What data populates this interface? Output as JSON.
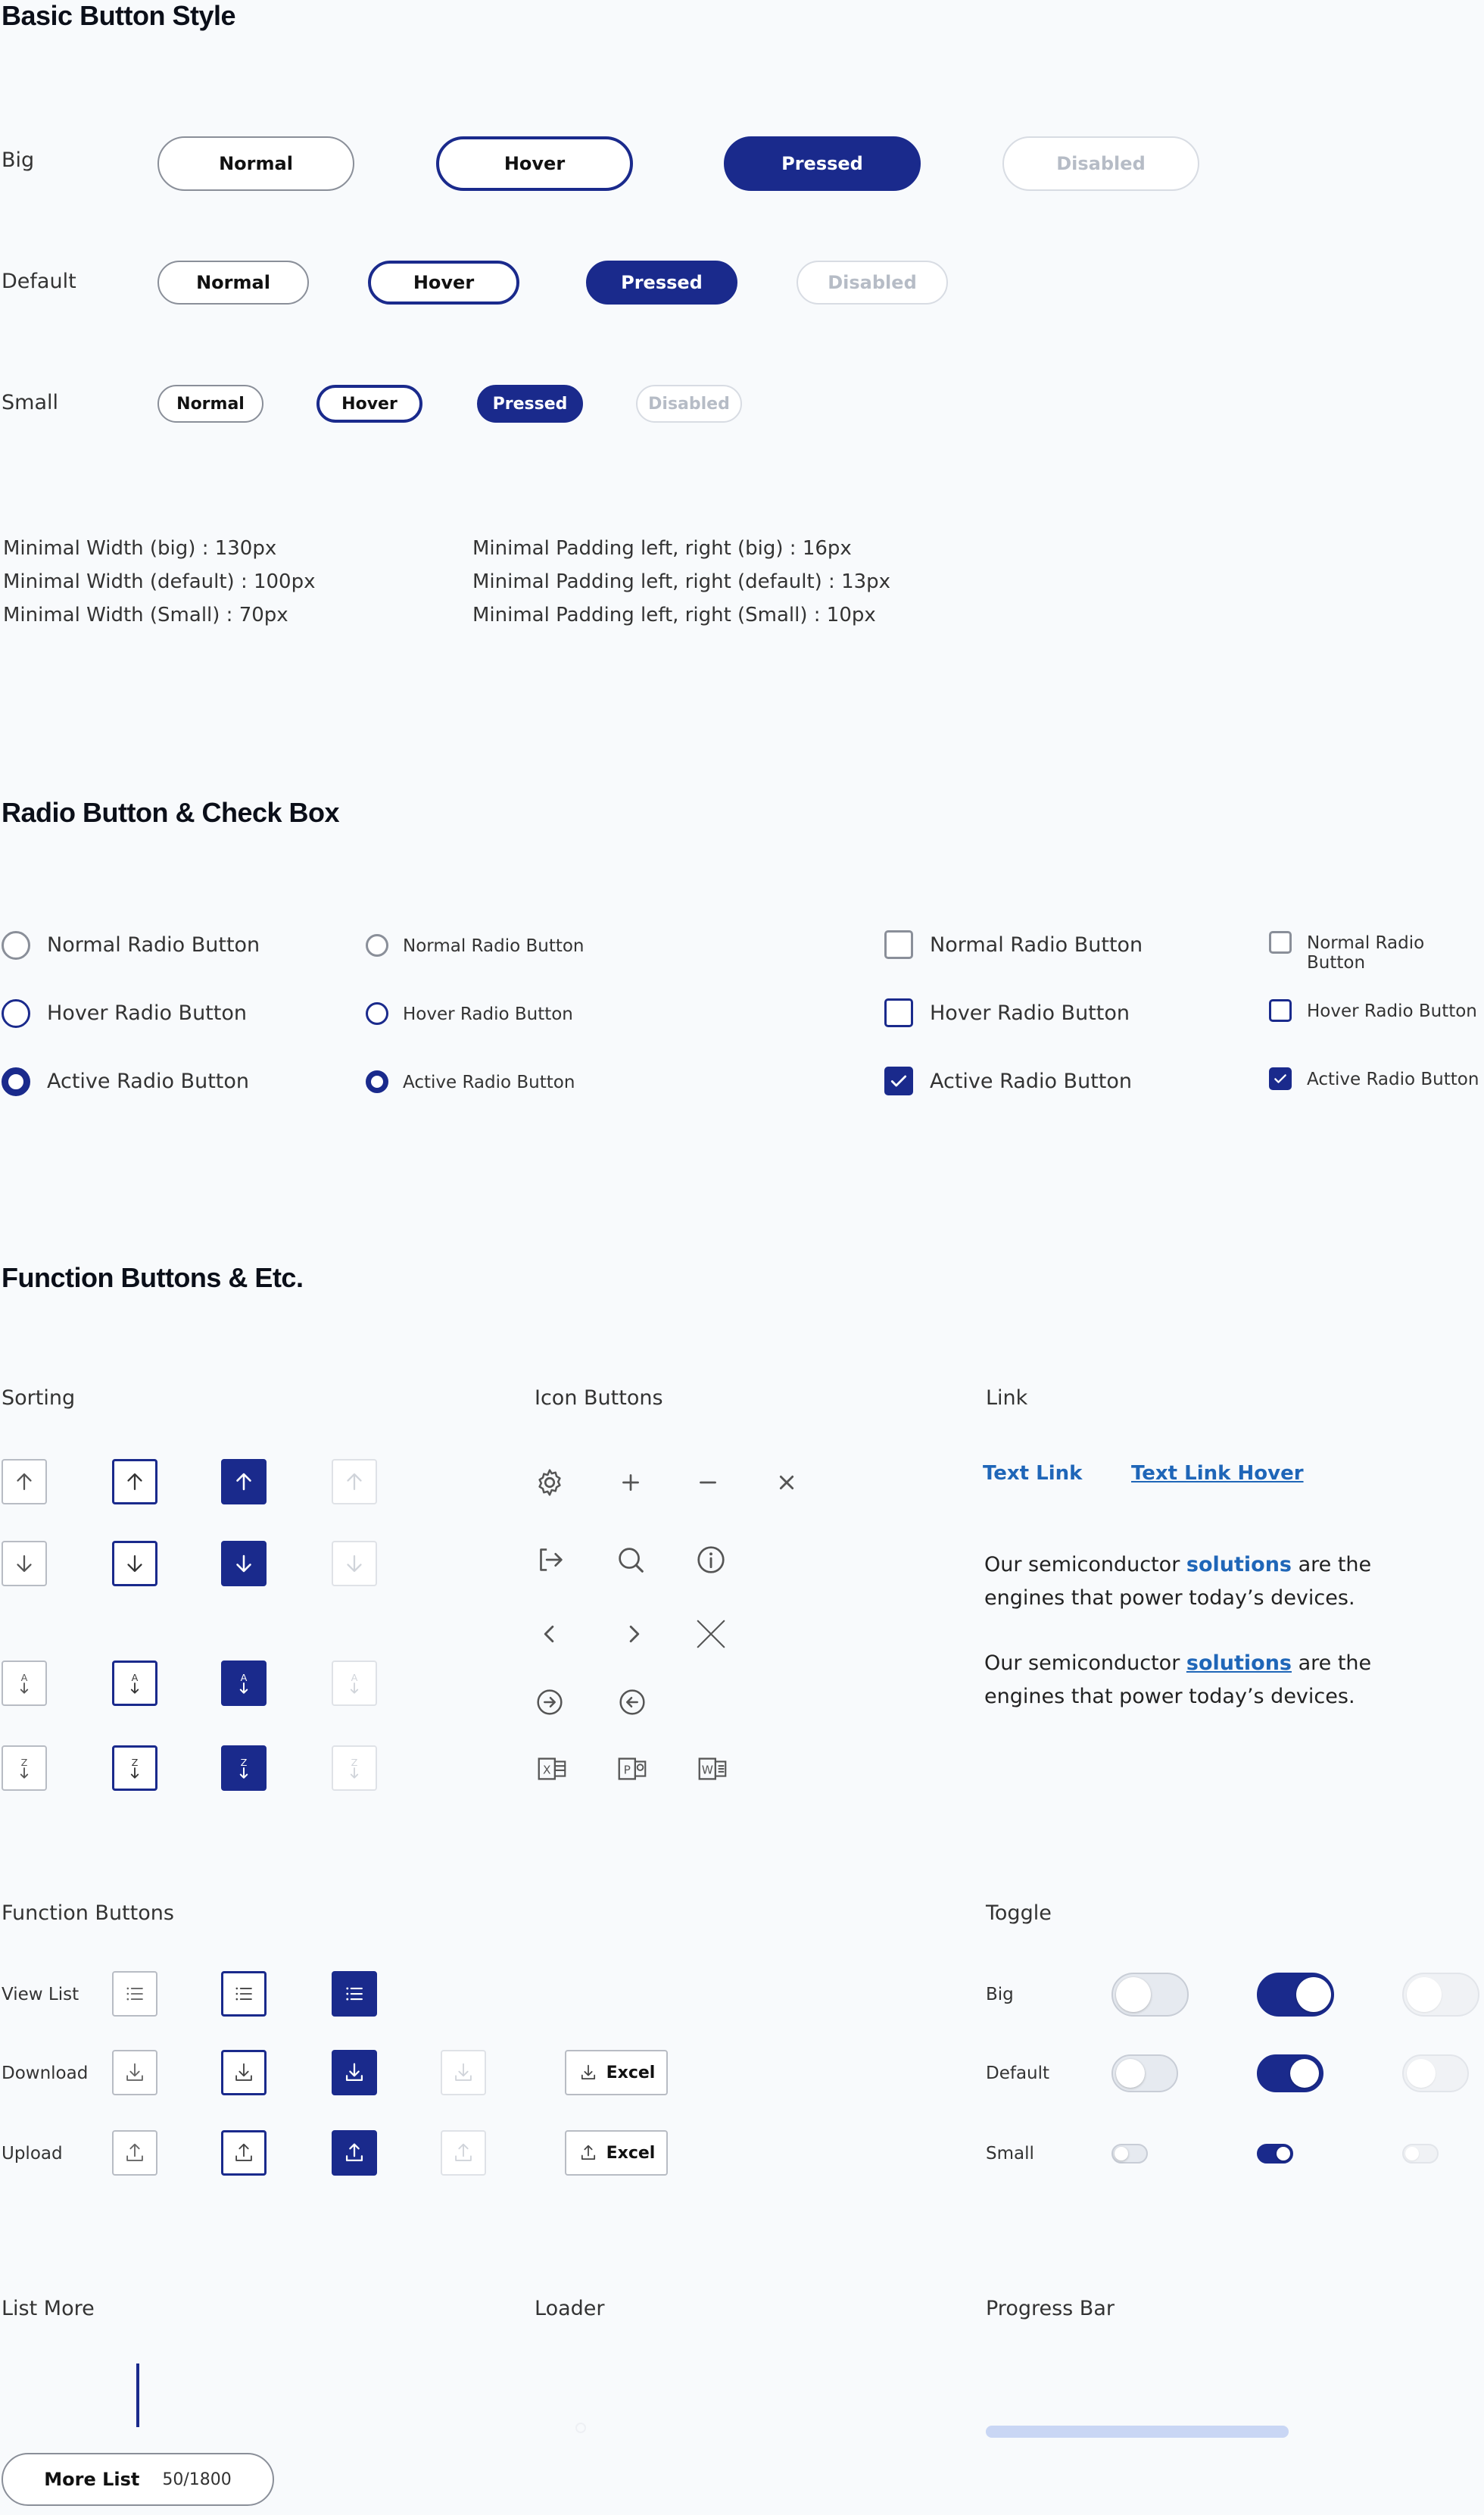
{
  "colors": {
    "primary": "#1a2a8c",
    "link": "#1f66b8",
    "border": "#8a8f99",
    "disabled": "#d8dce3"
  },
  "basic": {
    "title": "Basic Button Style",
    "rows": [
      {
        "label": "Big",
        "buttons": [
          "Normal",
          "Hover",
          "Pressed",
          "Disabled"
        ]
      },
      {
        "label": "Default",
        "buttons": [
          "Normal",
          "Hover",
          "Pressed",
          "Disabled"
        ]
      },
      {
        "label": "Small",
        "buttons": [
          "Normal",
          "Hover",
          "Pressed",
          "Disabled"
        ]
      }
    ],
    "notes_left": [
      "Minimal Width (big) : 130px",
      "Minimal Width (default) : 100px",
      "Minimal Width (Small) : 70px"
    ],
    "notes_right": [
      "Minimal Padding left, right (big) : 16px",
      "Minimal Padding left, right (default) : 13px",
      "Minimal Padding left, right (Small) : 10px"
    ]
  },
  "radio": {
    "title": "Radio Button & Check Box",
    "radio_big": [
      "Normal Radio Button",
      "Hover Radio Button",
      "Active Radio Button"
    ],
    "radio_small": [
      "Normal Radio Button",
      "Hover Radio Button",
      "Active Radio Button"
    ],
    "check_big": [
      "Normal Radio Button",
      "Hover Radio Button",
      "Active Radio Button"
    ],
    "check_small": [
      "Normal Radio Button",
      "Hover Radio Button",
      "Active Radio Button"
    ]
  },
  "func": {
    "title": "Function Buttons & Etc.",
    "sorting": "Sorting",
    "icon_buttons": "Icon Buttons",
    "link": "Link",
    "text_link": "Text Link",
    "text_link_hover": "Text Link Hover",
    "para1": {
      "a": "Our semiconductor ",
      "b": "solutions",
      "c": " are the engines that power today’s devices."
    },
    "para2": {
      "a": "Our semiconductor ",
      "b": "solutions",
      "c": " are the engines that power today’s devices."
    },
    "function_buttons": "Function Buttons",
    "view_list": "View List",
    "download": "Download",
    "upload": "Upload",
    "excel": "Excel",
    "toggle": "Toggle",
    "toggle_big": "Big",
    "toggle_default": "Default",
    "toggle_small": "Small",
    "list_more": "List More",
    "more_list": "More List",
    "more_count": "50/1800",
    "loader": "Loader",
    "progress_bar": "Progress Bar",
    "progress_value": 1.0
  }
}
